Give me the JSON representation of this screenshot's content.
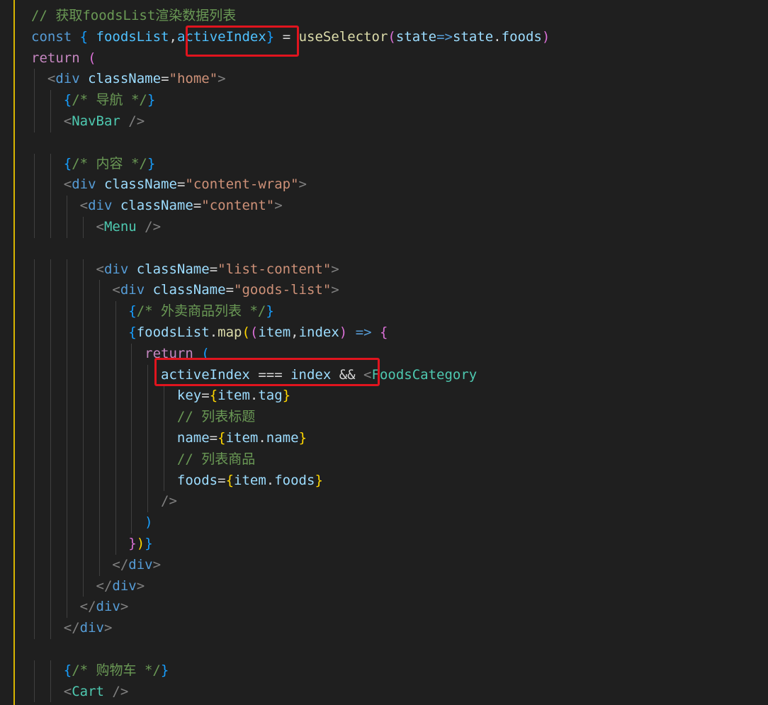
{
  "editor": {
    "language": "jsx",
    "theme_colors": {
      "background": "#1f1f1f",
      "comment": "#6a9955",
      "keyword": "#569cd6",
      "control": "#c586c0",
      "variable": "#9cdcfe",
      "function": "#dcdcaa",
      "string": "#ce9178",
      "tag": "#4ec9b0",
      "highlight": "#e0141e",
      "gutter_marker": "#d8b400"
    },
    "lines": [
      {
        "tokens": [
          {
            "t": "// 获取foodsList渲染数据列表",
            "c": "comment"
          }
        ]
      },
      {
        "tokens": [
          {
            "t": "const",
            "c": "keyword"
          },
          {
            "t": " ",
            "c": "plain"
          },
          {
            "t": "{",
            "c": "brace-blue"
          },
          {
            "t": " foodsList",
            "c": "const"
          },
          {
            "t": ",",
            "c": "plain"
          },
          {
            "t": "activeIndex",
            "c": "const"
          },
          {
            "t": "}",
            "c": "brace-blue"
          },
          {
            "t": " = ",
            "c": "plain"
          },
          {
            "t": "useSelector",
            "c": "function"
          },
          {
            "t": "(",
            "c": "brace-pink"
          },
          {
            "t": "state",
            "c": "variable"
          },
          {
            "t": "=>",
            "c": "keyword"
          },
          {
            "t": "state",
            "c": "variable"
          },
          {
            "t": ".",
            "c": "plain"
          },
          {
            "t": "foods",
            "c": "variable"
          },
          {
            "t": ")",
            "c": "brace-pink"
          }
        ]
      },
      {
        "tokens": [
          {
            "t": "return",
            "c": "control"
          },
          {
            "t": " ",
            "c": "plain"
          },
          {
            "t": "(",
            "c": "brace-pink"
          }
        ]
      },
      {
        "tokens": [
          {
            "t": "  ",
            "c": "plain"
          },
          {
            "t": "<",
            "c": "punct"
          },
          {
            "t": "div",
            "c": "keyword"
          },
          {
            "t": " className",
            "c": "attr"
          },
          {
            "t": "=",
            "c": "plain"
          },
          {
            "t": "\"home\"",
            "c": "string"
          },
          {
            "t": ">",
            "c": "punct"
          }
        ]
      },
      {
        "tokens": [
          {
            "t": "    ",
            "c": "plain"
          },
          {
            "t": "{",
            "c": "brace-blue"
          },
          {
            "t": "/* 导航 */",
            "c": "comment"
          },
          {
            "t": "}",
            "c": "brace-blue"
          }
        ]
      },
      {
        "tokens": [
          {
            "t": "    ",
            "c": "plain"
          },
          {
            "t": "<",
            "c": "punct"
          },
          {
            "t": "NavBar",
            "c": "tag"
          },
          {
            "t": " />",
            "c": "punct"
          }
        ]
      },
      {
        "tokens": [
          {
            "t": " ",
            "c": "plain"
          }
        ]
      },
      {
        "tokens": [
          {
            "t": "    ",
            "c": "plain"
          },
          {
            "t": "{",
            "c": "brace-blue"
          },
          {
            "t": "/* 内容 */",
            "c": "comment"
          },
          {
            "t": "}",
            "c": "brace-blue"
          }
        ]
      },
      {
        "tokens": [
          {
            "t": "    ",
            "c": "plain"
          },
          {
            "t": "<",
            "c": "punct"
          },
          {
            "t": "div",
            "c": "keyword"
          },
          {
            "t": " className",
            "c": "attr"
          },
          {
            "t": "=",
            "c": "plain"
          },
          {
            "t": "\"content-wrap\"",
            "c": "string"
          },
          {
            "t": ">",
            "c": "punct"
          }
        ]
      },
      {
        "tokens": [
          {
            "t": "      ",
            "c": "plain"
          },
          {
            "t": "<",
            "c": "punct"
          },
          {
            "t": "div",
            "c": "keyword"
          },
          {
            "t": " className",
            "c": "attr"
          },
          {
            "t": "=",
            "c": "plain"
          },
          {
            "t": "\"content\"",
            "c": "string"
          },
          {
            "t": ">",
            "c": "punct"
          }
        ]
      },
      {
        "tokens": [
          {
            "t": "        ",
            "c": "plain"
          },
          {
            "t": "<",
            "c": "punct"
          },
          {
            "t": "Menu",
            "c": "tag"
          },
          {
            "t": " />",
            "c": "punct"
          }
        ]
      },
      {
        "tokens": [
          {
            "t": " ",
            "c": "plain"
          }
        ]
      },
      {
        "tokens": [
          {
            "t": "        ",
            "c": "plain"
          },
          {
            "t": "<",
            "c": "punct"
          },
          {
            "t": "div",
            "c": "keyword"
          },
          {
            "t": " className",
            "c": "attr"
          },
          {
            "t": "=",
            "c": "plain"
          },
          {
            "t": "\"list-content\"",
            "c": "string"
          },
          {
            "t": ">",
            "c": "punct"
          }
        ]
      },
      {
        "tokens": [
          {
            "t": "          ",
            "c": "plain"
          },
          {
            "t": "<",
            "c": "punct"
          },
          {
            "t": "div",
            "c": "keyword"
          },
          {
            "t": " className",
            "c": "attr"
          },
          {
            "t": "=",
            "c": "plain"
          },
          {
            "t": "\"goods-list\"",
            "c": "string"
          },
          {
            "t": ">",
            "c": "punct"
          }
        ]
      },
      {
        "tokens": [
          {
            "t": "            ",
            "c": "plain"
          },
          {
            "t": "{",
            "c": "brace-blue"
          },
          {
            "t": "/* 外卖商品列表 */",
            "c": "comment"
          },
          {
            "t": "}",
            "c": "brace-blue"
          }
        ]
      },
      {
        "tokens": [
          {
            "t": "            ",
            "c": "plain"
          },
          {
            "t": "{",
            "c": "brace-blue"
          },
          {
            "t": "foodsList",
            "c": "variable"
          },
          {
            "t": ".",
            "c": "plain"
          },
          {
            "t": "map",
            "c": "function"
          },
          {
            "t": "(",
            "c": "brace-gold"
          },
          {
            "t": "(",
            "c": "brace-pink"
          },
          {
            "t": "item",
            "c": "variable"
          },
          {
            "t": ",",
            "c": "plain"
          },
          {
            "t": "index",
            "c": "variable"
          },
          {
            "t": ")",
            "c": "brace-pink"
          },
          {
            "t": " ",
            "c": "plain"
          },
          {
            "t": "=>",
            "c": "keyword"
          },
          {
            "t": " ",
            "c": "plain"
          },
          {
            "t": "{",
            "c": "brace-pink"
          }
        ]
      },
      {
        "tokens": [
          {
            "t": "              ",
            "c": "plain"
          },
          {
            "t": "return",
            "c": "control"
          },
          {
            "t": " ",
            "c": "plain"
          },
          {
            "t": "(",
            "c": "brace-blue"
          }
        ]
      },
      {
        "tokens": [
          {
            "t": "                ",
            "c": "plain"
          },
          {
            "t": "activeIndex",
            "c": "variable"
          },
          {
            "t": " === ",
            "c": "plain"
          },
          {
            "t": "index",
            "c": "variable"
          },
          {
            "t": " && ",
            "c": "plain"
          },
          {
            "t": "<",
            "c": "punct"
          },
          {
            "t": "FoodsCategory",
            "c": "tag"
          }
        ]
      },
      {
        "tokens": [
          {
            "t": "                  ",
            "c": "plain"
          },
          {
            "t": "key",
            "c": "attr"
          },
          {
            "t": "=",
            "c": "plain"
          },
          {
            "t": "{",
            "c": "brace-gold"
          },
          {
            "t": "item",
            "c": "variable"
          },
          {
            "t": ".",
            "c": "plain"
          },
          {
            "t": "tag",
            "c": "variable"
          },
          {
            "t": "}",
            "c": "brace-gold"
          }
        ]
      },
      {
        "tokens": [
          {
            "t": "                  ",
            "c": "plain"
          },
          {
            "t": "// 列表标题",
            "c": "comment"
          }
        ]
      },
      {
        "tokens": [
          {
            "t": "                  ",
            "c": "plain"
          },
          {
            "t": "name",
            "c": "attr"
          },
          {
            "t": "=",
            "c": "plain"
          },
          {
            "t": "{",
            "c": "brace-gold"
          },
          {
            "t": "item",
            "c": "variable"
          },
          {
            "t": ".",
            "c": "plain"
          },
          {
            "t": "name",
            "c": "variable"
          },
          {
            "t": "}",
            "c": "brace-gold"
          }
        ]
      },
      {
        "tokens": [
          {
            "t": "                  ",
            "c": "plain"
          },
          {
            "t": "// 列表商品",
            "c": "comment"
          }
        ]
      },
      {
        "tokens": [
          {
            "t": "                  ",
            "c": "plain"
          },
          {
            "t": "foods",
            "c": "attr"
          },
          {
            "t": "=",
            "c": "plain"
          },
          {
            "t": "{",
            "c": "brace-gold"
          },
          {
            "t": "item",
            "c": "variable"
          },
          {
            "t": ".",
            "c": "plain"
          },
          {
            "t": "foods",
            "c": "variable"
          },
          {
            "t": "}",
            "c": "brace-gold"
          }
        ]
      },
      {
        "tokens": [
          {
            "t": "                ",
            "c": "plain"
          },
          {
            "t": "/>",
            "c": "punct"
          }
        ]
      },
      {
        "tokens": [
          {
            "t": "              ",
            "c": "plain"
          },
          {
            "t": ")",
            "c": "brace-blue"
          }
        ]
      },
      {
        "tokens": [
          {
            "t": "            ",
            "c": "plain"
          },
          {
            "t": "}",
            "c": "brace-pink"
          },
          {
            "t": ")",
            "c": "brace-gold"
          },
          {
            "t": "}",
            "c": "brace-blue"
          }
        ]
      },
      {
        "tokens": [
          {
            "t": "          ",
            "c": "plain"
          },
          {
            "t": "</",
            "c": "punct"
          },
          {
            "t": "div",
            "c": "keyword"
          },
          {
            "t": ">",
            "c": "punct"
          }
        ]
      },
      {
        "tokens": [
          {
            "t": "        ",
            "c": "plain"
          },
          {
            "t": "</",
            "c": "punct"
          },
          {
            "t": "div",
            "c": "keyword"
          },
          {
            "t": ">",
            "c": "punct"
          }
        ]
      },
      {
        "tokens": [
          {
            "t": "      ",
            "c": "plain"
          },
          {
            "t": "</",
            "c": "punct"
          },
          {
            "t": "div",
            "c": "keyword"
          },
          {
            "t": ">",
            "c": "punct"
          }
        ]
      },
      {
        "tokens": [
          {
            "t": "    ",
            "c": "plain"
          },
          {
            "t": "</",
            "c": "punct"
          },
          {
            "t": "div",
            "c": "keyword"
          },
          {
            "t": ">",
            "c": "punct"
          }
        ]
      },
      {
        "tokens": [
          {
            "t": " ",
            "c": "plain"
          }
        ]
      },
      {
        "tokens": [
          {
            "t": "    ",
            "c": "plain"
          },
          {
            "t": "{",
            "c": "brace-blue"
          },
          {
            "t": "/* 购物车 */",
            "c": "comment"
          },
          {
            "t": "}",
            "c": "brace-blue"
          }
        ]
      },
      {
        "tokens": [
          {
            "t": "    ",
            "c": "plain"
          },
          {
            "t": "<",
            "c": "punct"
          },
          {
            "t": "Cart",
            "c": "tag"
          },
          {
            "t": " />",
            "c": "punct"
          }
        ]
      }
    ]
  }
}
